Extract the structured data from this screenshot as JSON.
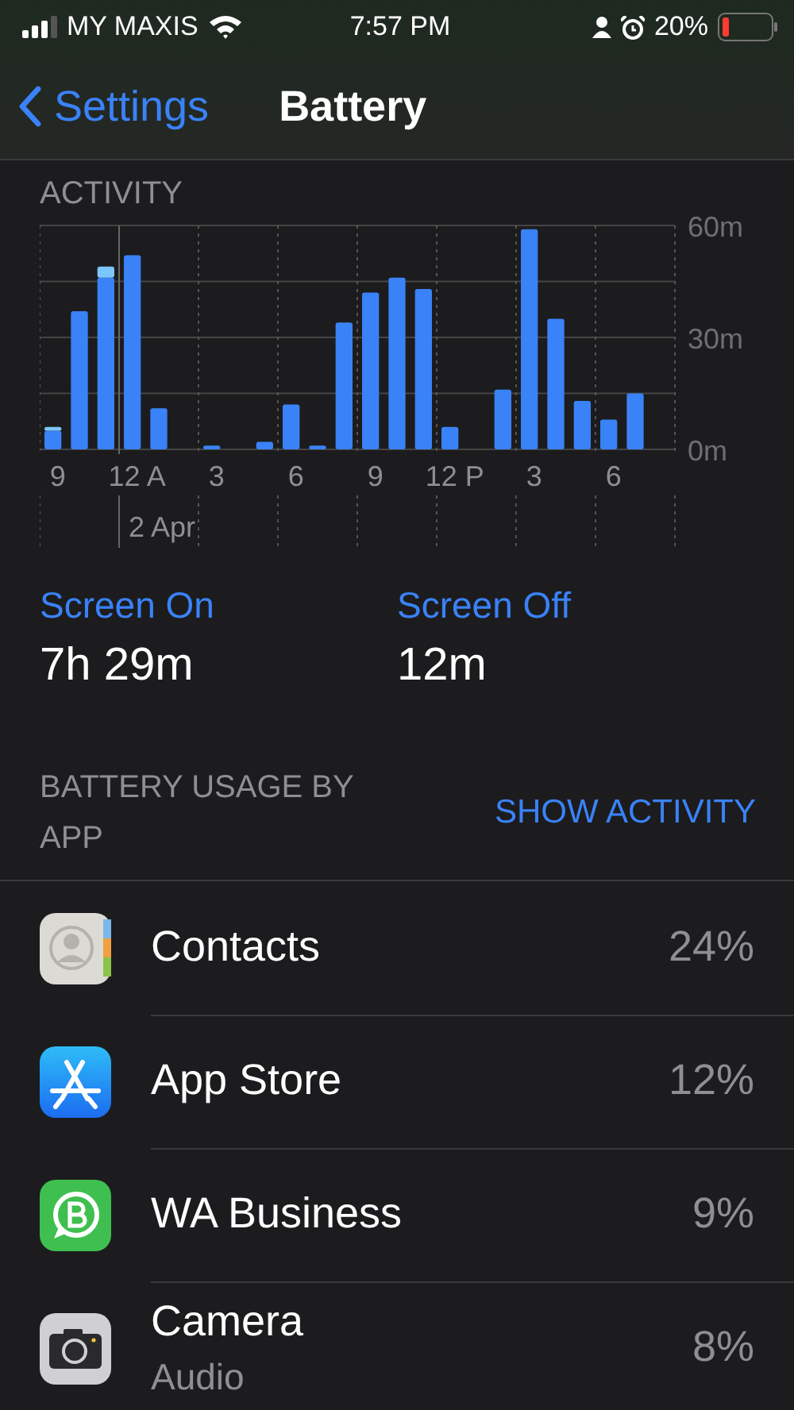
{
  "status_bar": {
    "carrier": "MY MAXIS",
    "time": "7:57 PM",
    "battery": "20%"
  },
  "nav": {
    "back": "Settings",
    "title": "Battery"
  },
  "activity": {
    "title": "ACTIVITY",
    "chart_data": {
      "type": "bar",
      "stacked": true,
      "categories": [
        "9",
        null,
        null,
        "12 A",
        null,
        null,
        "3",
        null,
        null,
        "6",
        null,
        null,
        "9",
        null,
        null,
        "12 P",
        null,
        null,
        "3",
        null,
        null,
        "6",
        null,
        null
      ],
      "series": [
        {
          "name": "Screen On",
          "color": "#3a82f7",
          "values": [
            5,
            37,
            46,
            52,
            11,
            0,
            1,
            0,
            2,
            12,
            1,
            34,
            42,
            46,
            43,
            6,
            0,
            16,
            59,
            35,
            13,
            8,
            15,
            0
          ]
        },
        {
          "name": "Screen Off",
          "color": "#7cc6fb",
          "values": [
            1,
            0,
            3,
            0,
            0,
            0,
            0,
            0,
            0,
            0,
            0,
            0,
            0,
            0,
            0,
            0,
            0,
            0,
            0,
            0,
            0,
            0,
            0,
            0
          ]
        }
      ],
      "ylim": [
        0,
        60
      ],
      "yticks": [
        {
          "value": 0,
          "label": "0m"
        },
        {
          "value": 30,
          "label": "30m"
        },
        {
          "value": 60,
          "label": "60m"
        }
      ],
      "annotations": [
        "2 Apr"
      ]
    }
  },
  "screen_time": [
    {
      "value": "7h 29m"
    },
    {
      "value": "12m"
    }
  ],
  "usage": {
    "title": "BATTERY USAGE BY APP",
    "action": "SHOW ACTIVITY"
  },
  "apps": [
    {
      "kind": "contacts",
      "name": "Contacts",
      "percent": "24%"
    },
    {
      "kind": "appstore",
      "name": "App Store",
      "percent": "12%"
    },
    {
      "kind": "wa",
      "name": "WA Business",
      "percent": "9%"
    },
    {
      "kind": "camera",
      "name": "Camera",
      "detail": "Audio",
      "percent": "8%"
    }
  ]
}
